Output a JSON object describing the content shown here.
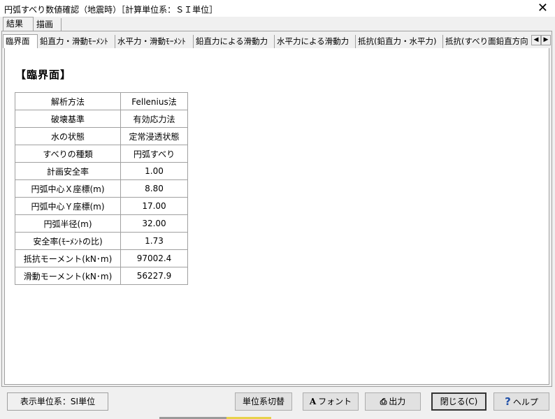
{
  "window": {
    "title": "円弧すべり数値確認（地震時）［計算単位系：ＳＩ単位］",
    "close_glyph": "✕"
  },
  "outer_tabs": [
    {
      "label": "結果",
      "active": true
    },
    {
      "label": "描画",
      "active": false
    }
  ],
  "inner_tabs": [
    {
      "label": "臨界面",
      "active": true
    },
    {
      "label": "鉛直力・滑動ﾓｰﾒﾝﾄ",
      "active": false
    },
    {
      "label": "水平力・滑動ﾓｰﾒﾝﾄ",
      "active": false
    },
    {
      "label": "鉛直力による滑動力",
      "active": false
    },
    {
      "label": "水平力による滑動力",
      "active": false
    },
    {
      "label": "抵抗(鉛直力・水平力)",
      "active": false
    },
    {
      "label": "抵抗(すべり面鉛直方向",
      "active": false
    }
  ],
  "tab_scroll": {
    "left": "◀",
    "right": "▶"
  },
  "section": {
    "title": "【臨界面】",
    "rows": [
      {
        "label": "解析方法",
        "value": "Fellenius法"
      },
      {
        "label": "破壊基準",
        "value": "有効応力法"
      },
      {
        "label": "水の状態",
        "value": "定常浸透状態"
      },
      {
        "label": "すべりの種類",
        "value": "円弧すべり"
      },
      {
        "label": "計画安全率",
        "value": "1.00"
      },
      {
        "label": "円弧中心Ｘ座標(m)",
        "value": "8.80"
      },
      {
        "label": "円弧中心Ｙ座標(m)",
        "value": "17.00"
      },
      {
        "label": "円弧半径(m)",
        "value": "32.00"
      },
      {
        "label": "安全率(ﾓｰﾒﾝﾄの比)",
        "value": "1.73"
      },
      {
        "label": "抵抗モーメント(kN･m)",
        "value": "97002.4"
      },
      {
        "label": "滑動モーメント(kN･m)",
        "value": "56227.9"
      }
    ]
  },
  "status": {
    "unit_display": "表示単位系：SI単位"
  },
  "buttons": {
    "unit_switch": "単位系切替",
    "font": {
      "icon": "A",
      "icon_name": "font-icon",
      "label": "フォント"
    },
    "output": {
      "icon": "⎙",
      "icon_name": "printer-icon",
      "label": "出力"
    },
    "close": "閉じる(C)",
    "help": {
      "icon": "?",
      "icon_name": "help-icon",
      "label": "ヘルプ"
    }
  },
  "colors": {
    "accent_help": "#1f4fa8",
    "accent_bar": "#e8d24a"
  }
}
